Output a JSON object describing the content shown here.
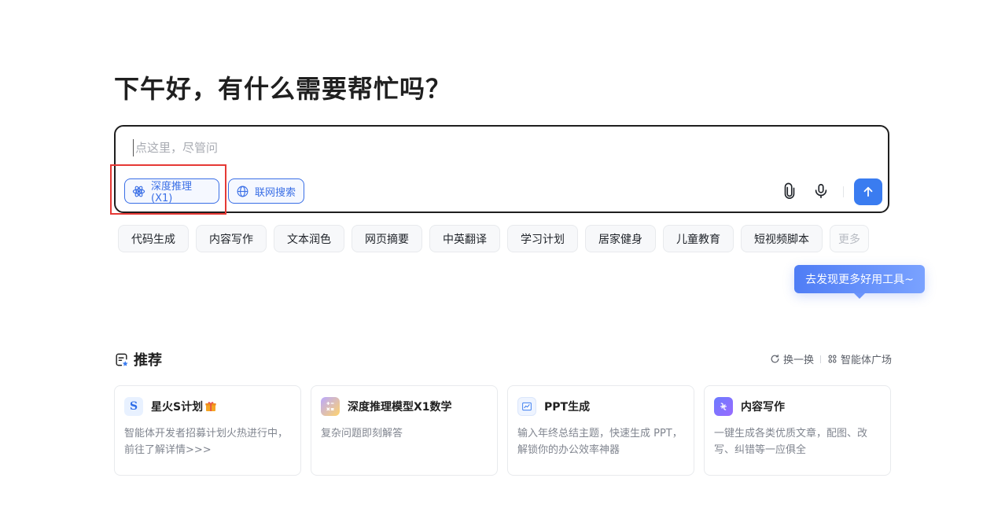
{
  "greeting": "下午好，有什么需要帮忙吗？",
  "input": {
    "placeholder": "点这里，尽管问",
    "value": ""
  },
  "modes": {
    "deep_label": "深度推理(X1)",
    "web_label": "联网搜索"
  },
  "icons": {
    "deep": "atom-icon",
    "web": "globe-icon",
    "attach": "paperclip-icon",
    "mic": "microphone-icon",
    "send": "arrow-up-icon"
  },
  "chips": [
    "代码生成",
    "内容写作",
    "文本润色",
    "网页摘要",
    "中英翻译",
    "学习计划",
    "居家健身",
    "儿童教育",
    "短视频脚本"
  ],
  "chips_more": "更多",
  "tooltip": "去发现更多好用工具~",
  "recommend": {
    "title": "推荐",
    "refresh": "换一换",
    "plaza": "智能体广场",
    "cards": [
      {
        "name": "星火S计划",
        "desc": "智能体开发者招募计划火热进行中，前往了解详情>>>"
      },
      {
        "name": "深度推理模型X1数学",
        "desc": "复杂问题即刻解答"
      },
      {
        "name": "PPT生成",
        "desc": "输入年终总结主题，快速生成 PPT，解锁你的办公效率神器"
      },
      {
        "name": "内容写作",
        "desc": "一键生成各类优质文章，配图、改写、纠错等一应俱全"
      }
    ]
  },
  "colors": {
    "accent": "#3a7cf0",
    "highlight": "#e53935",
    "tooltip": "#5b86f7"
  }
}
